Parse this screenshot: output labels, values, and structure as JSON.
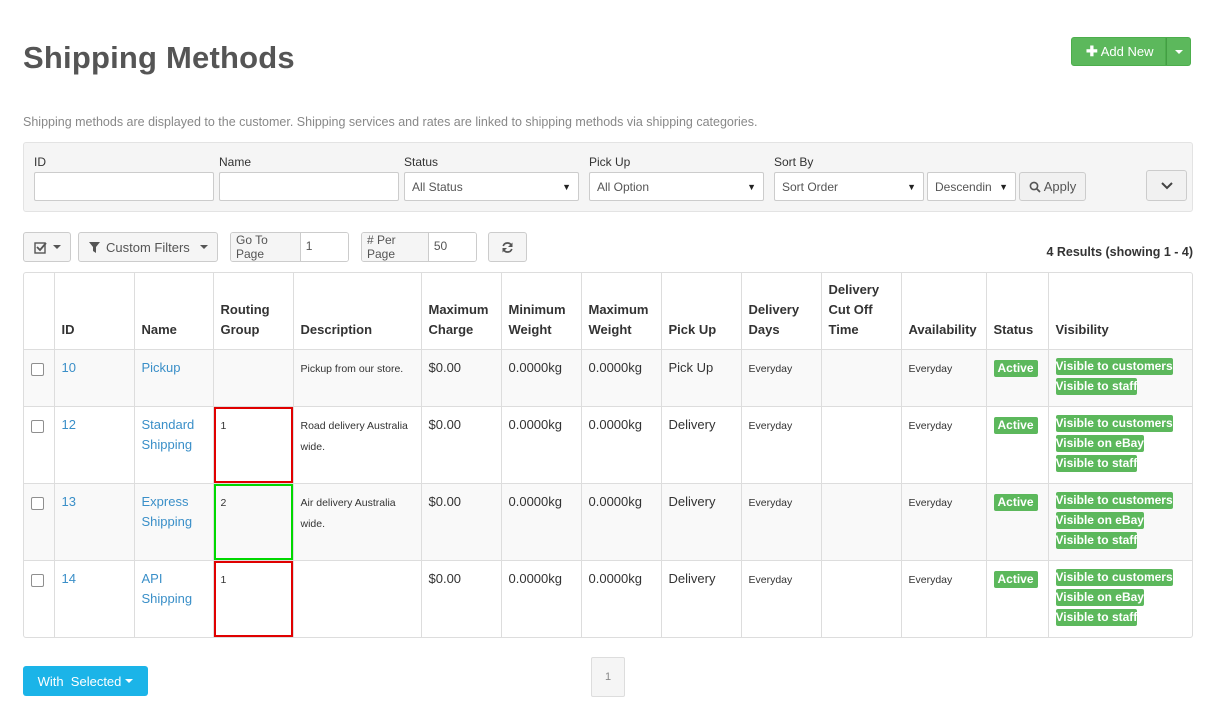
{
  "header": {
    "title": "Shipping Methods",
    "add_new_label": "Add New",
    "intro": "Shipping methods are displayed to the customer. Shipping services and rates are linked to shipping methods via shipping categories."
  },
  "filters": {
    "id_label": "ID",
    "id_value": "",
    "name_label": "Name",
    "name_value": "",
    "status_label": "Status",
    "status_value": "All Status",
    "pickup_label": "Pick Up",
    "pickup_value": "All Option",
    "sort_label": "Sort By",
    "sort_value": "Sort Order",
    "direction_value": "Descendin",
    "apply_label": "Apply"
  },
  "toolbar": {
    "custom_filters_label": "Custom Filters",
    "goto_label": "Go To Page",
    "goto_value": "1",
    "per_page_label": "# Per Page",
    "per_page_value": "50",
    "results_text": "4 Results (showing 1 - 4)"
  },
  "table": {
    "headers": {
      "id": "ID",
      "name": "Name",
      "routing_1": "Routing",
      "routing_2": "Group",
      "description": "Description",
      "max_charge_1": "Maximum",
      "max_charge_2": "Charge",
      "min_weight_1": "Minimum",
      "min_weight_2": "Weight",
      "max_weight_1": "Maximum",
      "max_weight_2": "Weight",
      "pickup": "Pick Up",
      "delivery_days_1": "Delivery",
      "delivery_days_2": "Days",
      "cutoff_1": "Delivery",
      "cutoff_2": "Cut Off",
      "cutoff_3": "Time",
      "availability": "Availability",
      "status": "Status",
      "visibility": "Visibility"
    },
    "rows": [
      {
        "id": "10",
        "name_1": "Pickup",
        "name_2": "",
        "routing": "",
        "description_1": "Pickup from our store.",
        "description_2": "",
        "max_charge": "$0.00",
        "min_weight": "0.0000kg",
        "max_weight": "0.0000kg",
        "pickup": "Pick Up",
        "delivery_days": "Everyday",
        "cutoff": "",
        "availability": "Everyday",
        "status": "Active",
        "visibility": [
          "Visible to customers",
          "Visible to staff"
        ]
      },
      {
        "id": "12",
        "name_1": "Standard",
        "name_2": "Shipping",
        "routing": "1",
        "description_1": "Road delivery Australia",
        "description_2": "wide.",
        "max_charge": "$0.00",
        "min_weight": "0.0000kg",
        "max_weight": "0.0000kg",
        "pickup": "Delivery",
        "delivery_days": "Everyday",
        "cutoff": "",
        "availability": "Everyday",
        "status": "Active",
        "visibility": [
          "Visible to customers",
          "Visible on eBay",
          "Visible to staff"
        ]
      },
      {
        "id": "13",
        "name_1": "Express",
        "name_2": "Shipping",
        "routing": "2",
        "description_1": "Air delivery Australia",
        "description_2": "wide.",
        "max_charge": "$0.00",
        "min_weight": "0.0000kg",
        "max_weight": "0.0000kg",
        "pickup": "Delivery",
        "delivery_days": "Everyday",
        "cutoff": "",
        "availability": "Everyday",
        "status": "Active",
        "visibility": [
          "Visible to customers",
          "Visible on eBay",
          "Visible to staff"
        ]
      },
      {
        "id": "14",
        "name_1": "API",
        "name_2": "Shipping",
        "routing": "1",
        "description_1": "",
        "description_2": "",
        "max_charge": "$0.00",
        "min_weight": "0.0000kg",
        "max_weight": "0.0000kg",
        "pickup": "Delivery",
        "delivery_days": "Everyday",
        "cutoff": "",
        "availability": "Everyday",
        "status": "Active",
        "visibility": [
          "Visible to customers",
          "Visible on eBay",
          "Visible to staff"
        ]
      }
    ]
  },
  "footer": {
    "with_selected_label": "With  Selected",
    "page_number": "1"
  },
  "colors": {
    "success": "#5cb85c",
    "link": "#3a8fc8",
    "info": "#1bb4e8",
    "highlight_red": "#e00000",
    "highlight_green": "#00d800"
  },
  "icons": {
    "add": "plus-icon",
    "apply": "search-icon",
    "expand": "chevron-down-icon",
    "select": "checkbox-icon",
    "filter": "filter-icon",
    "refresh": "refresh-icon"
  }
}
